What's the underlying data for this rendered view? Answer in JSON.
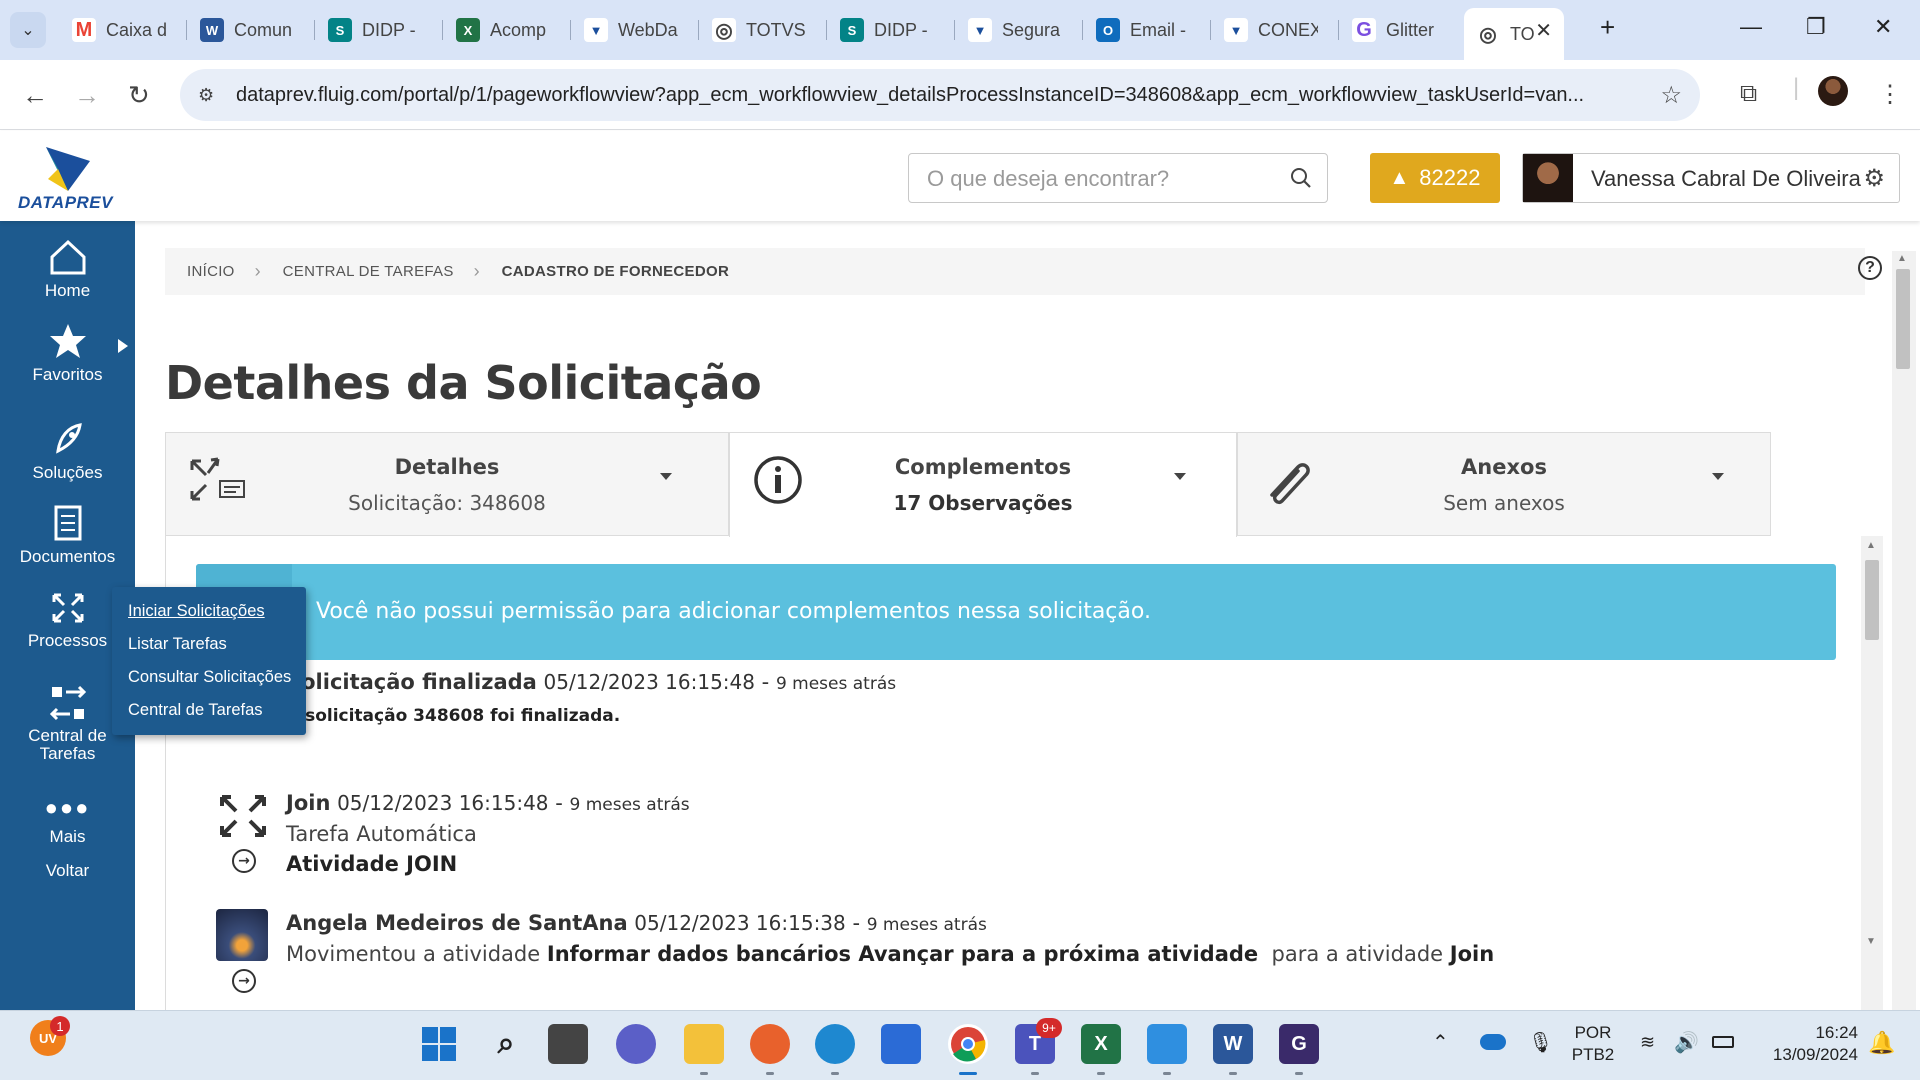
{
  "browser": {
    "tabs": [
      {
        "label": "Caixa d",
        "icon": "gmail-icon",
        "color": "#ea4335",
        "glyph": "M"
      },
      {
        "label": "Comun",
        "icon": "word-icon",
        "color": "#2b579a",
        "glyph": "W"
      },
      {
        "label": "DIDP -",
        "icon": "sharepoint-icon",
        "color": "#038387",
        "glyph": "S"
      },
      {
        "label": "Acomp",
        "icon": "excel-icon",
        "color": "#217346",
        "glyph": "X"
      },
      {
        "label": "WebDa",
        "icon": "dataprev-icon",
        "color": "#1b4f9c",
        "glyph": "▼"
      },
      {
        "label": "TOTVS",
        "icon": "totvs-icon",
        "color": "#444444",
        "glyph": "◎"
      },
      {
        "label": "DIDP -",
        "icon": "sharepoint-icon",
        "color": "#038387",
        "glyph": "S"
      },
      {
        "label": "Segura",
        "icon": "dataprev-icon",
        "color": "#1b4f9c",
        "glyph": "▼"
      },
      {
        "label": "Email -",
        "icon": "outlook-icon",
        "color": "#0f6cbd",
        "glyph": "O"
      },
      {
        "label": "CONEX",
        "icon": "dataprev-icon",
        "color": "#1b4f9c",
        "glyph": "▼"
      },
      {
        "label": "Glitter",
        "icon": "glitter-icon",
        "color": "#7b4fe0",
        "glyph": "G"
      }
    ],
    "active_tab": {
      "label": "TO",
      "icon": "totvs-icon"
    },
    "url": "dataprev.fluig.com/portal/p/1/pageworkflowview?app_ecm_workflowview_detailsProcessInstanceID=348608&app_ecm_workflowview_taskUserId=van..."
  },
  "header": {
    "logo_text": "DATAPREV",
    "search_placeholder": "O que deseja encontrar?",
    "alert_count": "82222",
    "user_name": "Vanessa Cabral De Oliveira"
  },
  "leftnav": {
    "items": [
      {
        "label": "Home",
        "icon": "home-icon"
      },
      {
        "label": "Favoritos",
        "icon": "star-icon"
      },
      {
        "label": "Soluções",
        "icon": "rocket-icon"
      },
      {
        "label": "Documentos",
        "icon": "documents-icon"
      },
      {
        "label": "Processos",
        "icon": "processes-icon"
      },
      {
        "label": "Central de Tarefas",
        "icon": "tasks-icon"
      },
      {
        "label": "Mais",
        "icon": "more-icon"
      },
      {
        "label": "Voltar",
        "icon": ""
      }
    ],
    "flyout": [
      "Iniciar Solicitações",
      "Listar Tarefas",
      "Consultar Solicitações",
      "Central de Tarefas"
    ]
  },
  "breadcrumb": [
    "Início",
    "Central de Tarefas",
    "Cadastro de Fornecedor"
  ],
  "page_title": "Detalhes da Solicitação",
  "cards": [
    {
      "title": "Detalhes",
      "subtitle": "Solicitação: 348608",
      "icon": "process-card-icon"
    },
    {
      "title": "Complementos",
      "subtitle": "17 Observações",
      "icon": "info-icon"
    },
    {
      "title": "Anexos",
      "subtitle": "Sem anexos",
      "icon": "paperclip-icon"
    }
  ],
  "banner": "Você não possui permissão para adicionar complementos nessa solicitação.",
  "timeline": [
    {
      "who": "Solicitação finalizada",
      "date": "05/12/2023 16:15:48",
      "ago": "9 meses atrás",
      "line1": "A solicitação  348608  foi finalizada."
    },
    {
      "who": "Join",
      "date": "05/12/2023 16:15:48",
      "ago": "9 meses atrás",
      "line1": "Tarefa Automática",
      "line2": "Atividade JOIN"
    },
    {
      "who": "Angela Medeiros de SantAna",
      "date": "05/12/2023 16:15:38",
      "ago": "9 meses atrás",
      "line_prefix": "Movimentou a atividade",
      "line_bold": "Informar dados bancários Avançar para a próxima atividade",
      "line_mid": "para a atividade",
      "line_end": "Join"
    }
  ],
  "taskbar": {
    "uv_badge": "UV",
    "uv_count": "1",
    "teams_count": "9+",
    "lang": "POR",
    "kbd": "PTB2",
    "time": "16:24",
    "date": "13/09/2024"
  },
  "colors": {
    "nav_bg": "#1d5a8e",
    "alert": "#e0a81e",
    "banner": "#5bc0de"
  }
}
